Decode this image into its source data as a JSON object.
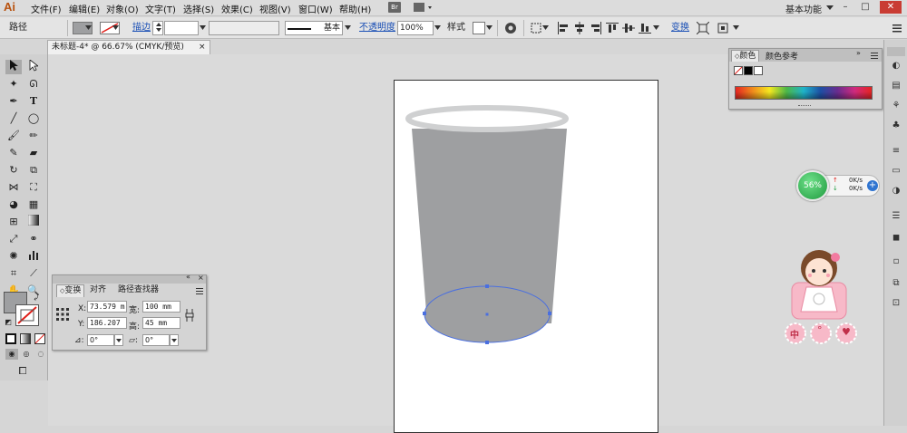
{
  "app": {
    "logo": "Ai",
    "workspace": "基本功能"
  },
  "menu": [
    "文件(F)",
    "编辑(E)",
    "对象(O)",
    "文字(T)",
    "选择(S)",
    "效果(C)",
    "视图(V)",
    "窗口(W)",
    "帮助(H)"
  ],
  "menu_extra": {
    "br": "Br"
  },
  "window_controls": {
    "minimize": "–",
    "maximize": "□",
    "close": "✕"
  },
  "control_bar": {
    "selection_label": "路径",
    "fill_color": "#9e9fa1",
    "stroke_label": "描边",
    "stroke_profile": "基本",
    "opacity_label": "不透明度",
    "opacity_value": "100%",
    "style_label": "样式",
    "transform_label": "变换"
  },
  "document_tab": {
    "title": "未标题-4* @ 66.67% (CMYK/预览)",
    "close": "×"
  },
  "transform_panel": {
    "tabs": [
      "变换",
      "对齐",
      "路径查找器"
    ],
    "x_label": "X:",
    "x_value": "73.579 m",
    "y_label": "Y:",
    "y_value": "186.207",
    "w_label": "宽:",
    "w_value": "100 mm",
    "h_label": "高:",
    "h_value": "45 mm",
    "rotate_value": "0°",
    "shear_value": "0°"
  },
  "color_panel": {
    "tabs": [
      "颜色",
      "颜色参考"
    ]
  },
  "speed_widget": {
    "percent": "56%",
    "upload": "0K/s",
    "download": "0K/s"
  },
  "sticker": {
    "labels": [
      "中",
      "°",
      "♥"
    ]
  },
  "colors": {
    "cup_body": "#9e9fa1",
    "cup_rim": "#cfd0d1",
    "selection": "#4a6fe0",
    "accent_link": "#1a4fb5"
  }
}
